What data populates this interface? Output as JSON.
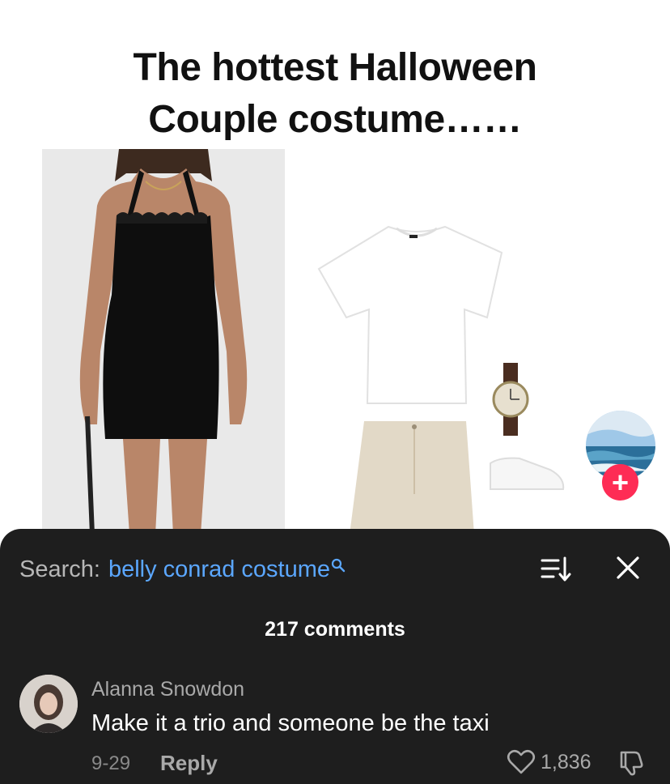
{
  "video": {
    "overlay_title_line1": "The hottest Halloween",
    "overlay_title_line2": "Couple costume……"
  },
  "creator": {
    "follow_label": "+"
  },
  "comments_sheet": {
    "search_label": "Search:",
    "search_query": "belly conrad costume",
    "comment_count": "217 comments",
    "comments": [
      {
        "author": "Alanna Snowdon",
        "text": "Make it a trio and someone be the taxi",
        "date": "9-29",
        "reply_label": "Reply",
        "likes": "1,836"
      }
    ]
  },
  "colors": {
    "sheet_background": "#1e1e1e",
    "search_link": "#5ba7ff",
    "follow_button": "#fe2c55"
  },
  "icons": [
    "search-icon",
    "sort-icon",
    "close-icon",
    "heart-icon",
    "dislike-icon",
    "plus-icon"
  ]
}
